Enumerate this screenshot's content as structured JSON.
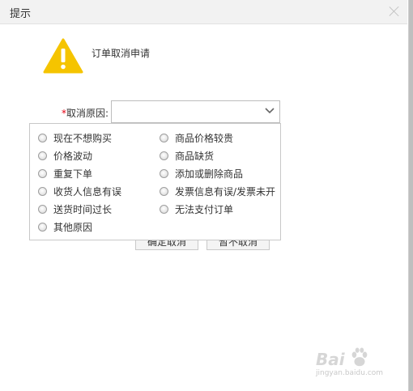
{
  "dialog": {
    "title": "提示",
    "close_icon": "close-icon",
    "warning_icon": "warning-triangle-icon",
    "message": "订单取消申请"
  },
  "form": {
    "required_mark": "*",
    "reason_label": "取消原因:",
    "reason_value": "",
    "dropdown_icon": "chevron-down-icon"
  },
  "reasons": [
    "现在不想购买",
    "商品价格较贵",
    "价格波动",
    "商品缺货",
    "重复下单",
    "添加或删除商品",
    "收货人信息有误",
    "发票信息有误/发票未开",
    "送货时间过长",
    "无法支付订单",
    "其他原因"
  ],
  "buttons": {
    "confirm_label": "确定取消",
    "cancel_label": "暂不取消"
  },
  "watermark": {
    "brand": "Bai",
    "paw_icon": "baidu-paw-icon",
    "sub": "jingyan.baidu.com"
  },
  "colors": {
    "warning": "#f5c400",
    "required": "#e60012"
  }
}
